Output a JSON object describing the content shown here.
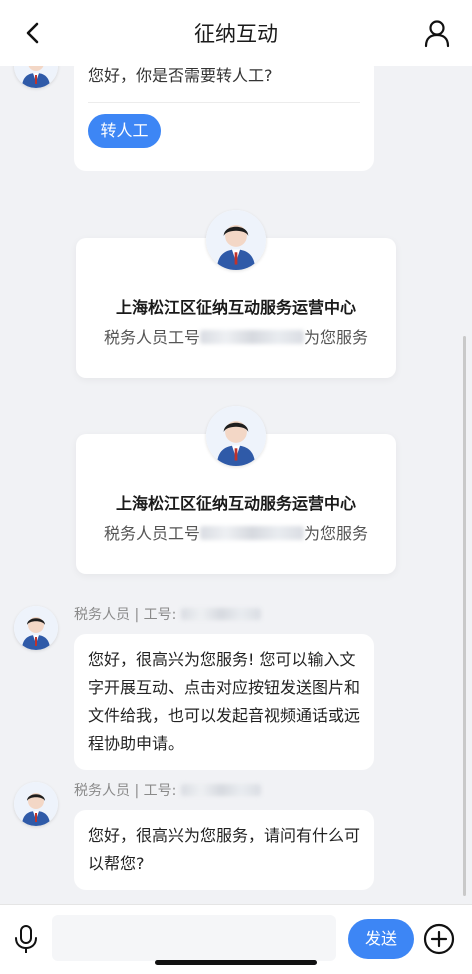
{
  "header": {
    "title": "征纳互动",
    "back_icon": "chevron-left-icon",
    "user_icon": "user-icon"
  },
  "transfer_prompt": {
    "question": "您好，你是否需要转人工?",
    "button_label": "转人工"
  },
  "agent_cards": [
    {
      "name": "上海松江区征纳互动服务运营中心",
      "prefix": "税务人员工号",
      "suffix": "为您服务"
    },
    {
      "name": "上海松江区征纳互动服务运营中心",
      "prefix": "税务人员工号",
      "suffix": "为您服务"
    }
  ],
  "messages": [
    {
      "meta": "税务人员 | 工号:",
      "text": "您好，很高兴为您服务! 您可以输入文字开展互动、点击对应按钮发送图片和文件给我，也可以发起音视频通话或远程协助申请。"
    },
    {
      "meta": "税务人员 | 工号:",
      "text": "您好，很高兴为您服务，请问有什么可以帮您?"
    }
  ],
  "input_bar": {
    "placeholder": "",
    "send_label": "发送",
    "mic_icon": "microphone-icon",
    "plus_icon": "plus-circle-icon"
  },
  "colors": {
    "accent": "#3d86f5",
    "background": "#f1f2f5"
  }
}
